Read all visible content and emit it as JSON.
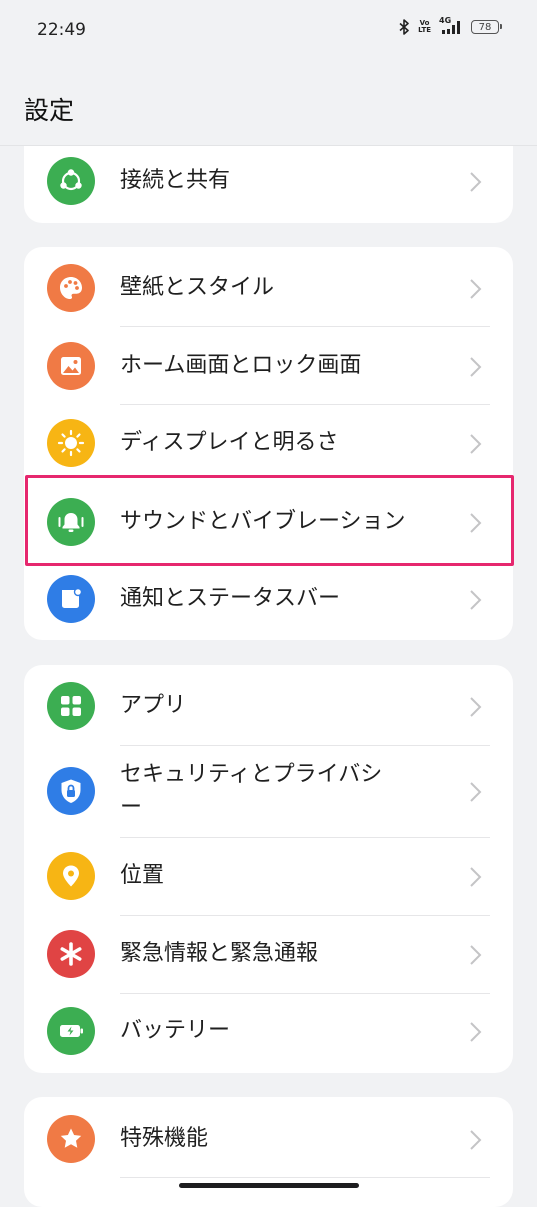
{
  "status_bar": {
    "time": "22:49",
    "volte_top": "Vo",
    "volte_bottom": "LTE",
    "network": "4G",
    "battery": "78"
  },
  "header": {
    "title": "設定"
  },
  "groups": [
    {
      "items": [
        {
          "label": "接続と共有",
          "icon": "share-icon",
          "color": "#3cae52"
        }
      ]
    },
    {
      "items": [
        {
          "label": "壁紙とスタイル",
          "icon": "palette-icon",
          "color": "#f07a45"
        },
        {
          "label": "ホーム画面とロック画面",
          "icon": "image-icon",
          "color": "#f07a45"
        },
        {
          "label": "ディスプレイと明るさ",
          "icon": "sun-icon",
          "color": "#f7b514"
        },
        {
          "label": "サウンドとバイブレーション",
          "icon": "bell-icon",
          "color": "#3cae52"
        },
        {
          "label": "通知とステータスバー",
          "icon": "notification-icon",
          "color": "#2f7de6"
        }
      ]
    },
    {
      "items": [
        {
          "label": "アプリ",
          "icon": "apps-grid-icon",
          "color": "#3cae52"
        },
        {
          "label": "セキュリティとプライバシ",
          "label_line2": "ー",
          "icon": "shield-lock-icon",
          "color": "#2f7de6"
        },
        {
          "label": "位置",
          "icon": "location-pin-icon",
          "color": "#f7b514"
        },
        {
          "label": "緊急情報と緊急通報",
          "icon": "asterisk-icon",
          "color": "#e04444"
        },
        {
          "label": "バッテリー",
          "icon": "battery-icon",
          "color": "#3cae52"
        }
      ]
    },
    {
      "items": [
        {
          "label": "特殊機能",
          "icon": "star-icon",
          "color": "#f07a45"
        }
      ]
    }
  ],
  "highlight_color": "#e6276e"
}
